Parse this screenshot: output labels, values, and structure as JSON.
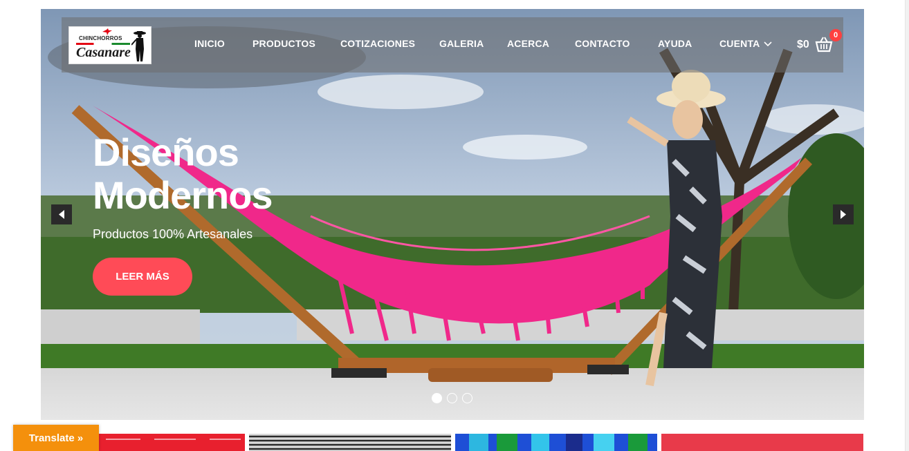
{
  "logo": {
    "small_text": "CHINCHORROS",
    "main_text": "Casanare"
  },
  "nav": {
    "items": [
      {
        "label": "INICIO"
      },
      {
        "label": "PRODUCTOS"
      },
      {
        "label": "COTIZACIONES"
      },
      {
        "label": "GALERIA"
      },
      {
        "label": "ACERCA"
      },
      {
        "label": "CONTACTO"
      },
      {
        "label": "AYUDA"
      },
      {
        "label": "CUENTA"
      }
    ]
  },
  "cart": {
    "total": "$0",
    "count": "0"
  },
  "hero": {
    "title_line1": "Diseños",
    "title_line2": "Modernos",
    "subtitle": "Productos 100% Artesanales",
    "button_label": "LEER MÁS",
    "active_slide": 1,
    "slide_count": 3
  },
  "translate": {
    "label": "Translate »"
  },
  "colors": {
    "accent": "#ff4b57",
    "hammock": "#f0288a",
    "translate": "#f4900c"
  },
  "icons": [
    "chevron-down-icon",
    "shopping-basket-icon",
    "arrow-left-icon",
    "arrow-right-icon"
  ]
}
